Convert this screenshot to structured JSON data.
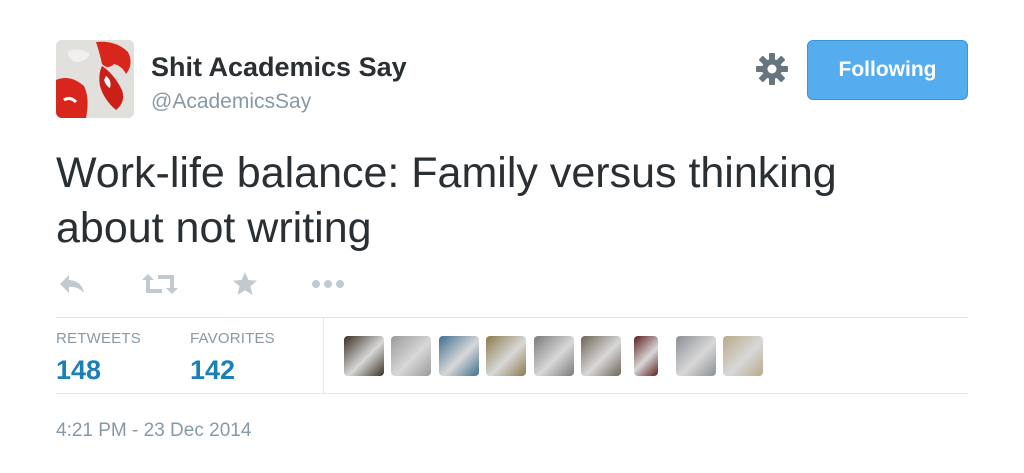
{
  "author": {
    "name": "Shit Academics Say",
    "handle": "@AcademicsSay",
    "avatar_icon": "red-sketch-avatar"
  },
  "header": {
    "settings_icon": "gear-icon",
    "follow_label": "Following",
    "follow_color": "#55acee"
  },
  "tweet": {
    "text": "Work-life balance: Family versus thinking about not writing",
    "timestamp": "4:21 PM - 23 Dec 2014"
  },
  "actions": [
    {
      "name": "reply",
      "icon": "reply-icon"
    },
    {
      "name": "retweet",
      "icon": "retweet-icon"
    },
    {
      "name": "favorite",
      "icon": "star-icon"
    },
    {
      "name": "more",
      "icon": "more-dots-icon"
    }
  ],
  "stats": {
    "retweets_label": "RETWEETS",
    "retweets_count": "148",
    "favorites_label": "FAVORITES",
    "favorites_count": "142"
  },
  "favoriters": [
    {
      "color": "#3a3022"
    },
    {
      "color": "#9a9a9a"
    },
    {
      "color": "#3f6f8f"
    },
    {
      "color": "#8a7a4a"
    },
    {
      "color": "#7a7a7a"
    },
    {
      "color": "#6e6458"
    },
    {
      "color": "#5a1e1e"
    },
    {
      "color": "#8a8f95"
    },
    {
      "color": "#b8aa8a"
    }
  ],
  "colors": {
    "link_blue": "#1b7fb8",
    "muted_text": "#8899a6",
    "divider": "#e1e8ed",
    "text": "#292f33"
  }
}
